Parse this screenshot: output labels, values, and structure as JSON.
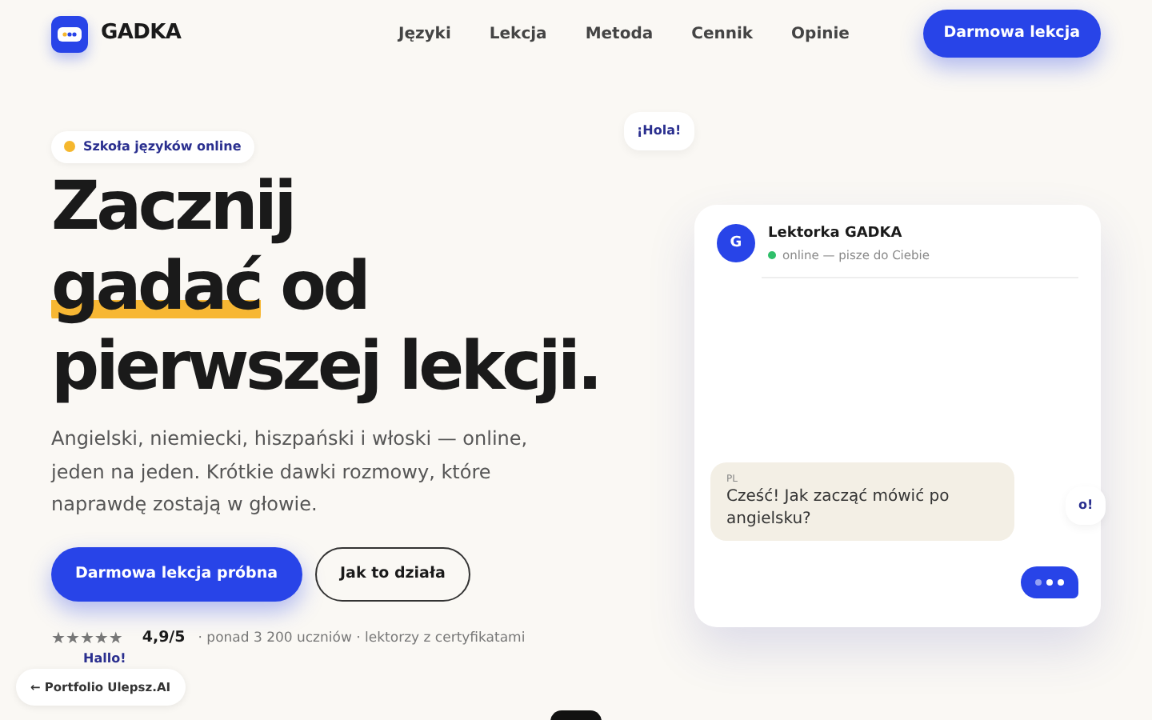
{
  "brand": {
    "name": "GADKA"
  },
  "nav": [
    {
      "label": "Języki"
    },
    {
      "label": "Lekcja"
    },
    {
      "label": "Metoda"
    },
    {
      "label": "Cennik"
    },
    {
      "label": "Opinie"
    }
  ],
  "nav_cta": "Darmowa lekcja",
  "hero": {
    "badge": "Szkoła języków online",
    "heading": {
      "before": "Zacznij",
      "highlight": "gadać",
      "after": "od pierwszej lekcji."
    },
    "lead": "Angielski, niemiecki, hiszpański i włoski — online, jeden na jeden. Krótkie dawki rozmowy, które naprawdę zostają w głowie.",
    "primary_button": "Darmowa lekcja próbna",
    "secondary_button": "Jak to działa",
    "rating": {
      "stars": 5,
      "score": "4,9/5",
      "details": "· ponad 3 200 uczniów · lektorzy z certyfikatami"
    }
  },
  "floating_bubbles": [
    "¡Hola!",
    "Hallo!",
    "o!"
  ],
  "chat": {
    "avatar": "G",
    "name": "Lektorka GADKA",
    "online": true,
    "status": "online — pisze do Ciebie",
    "messages": [
      {
        "kind": "incoming",
        "lang": "PL",
        "text": "Cześć! Jak zacząć mówić po angielsku?"
      },
      {
        "kind": "typing"
      }
    ]
  },
  "back_link": "← Portfolio Ulepsz.AI"
}
